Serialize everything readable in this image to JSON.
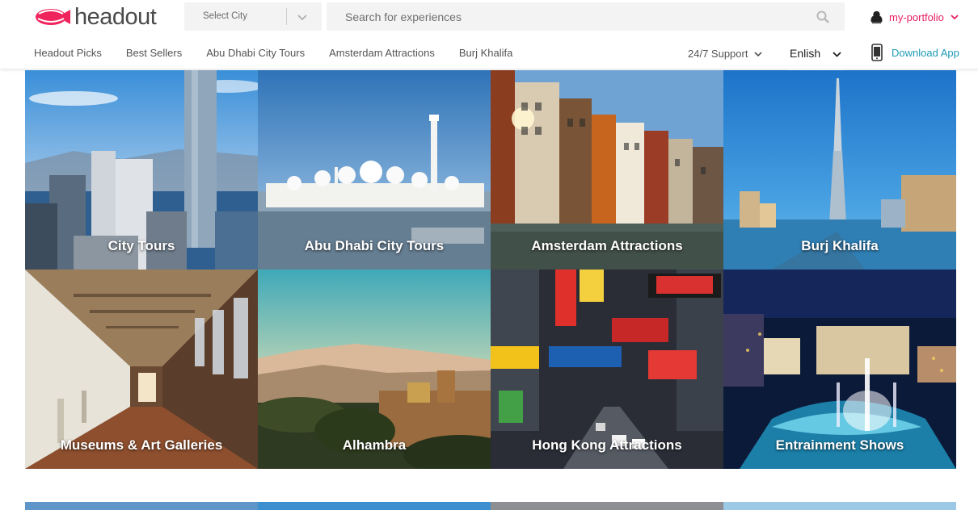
{
  "header": {
    "logo_text": "headout",
    "city_select": {
      "label": "Select City"
    },
    "search": {
      "placeholder": "Search for experiences"
    },
    "user": {
      "name": "my-portfolio"
    }
  },
  "nav": {
    "links": [
      "Headout Picks",
      "Best Sellers",
      "Abu Dhabi City Tours",
      "Amsterdam Attractions",
      "Burj Khalifa"
    ],
    "support": "24/7 Support",
    "language": "Enlish",
    "download": "Download App"
  },
  "colors": {
    "brand_pink": "#e91e63",
    "download_teal": "#1e9bb3"
  },
  "tiles": [
    {
      "title": "City Tours"
    },
    {
      "title": "Abu Dhabi City Tours"
    },
    {
      "title": "Amsterdam Attractions"
    },
    {
      "title": "Burj Khalifa"
    },
    {
      "title": "Museums & Art Galleries"
    },
    {
      "title": "Alhambra"
    },
    {
      "title": "Hong Kong Attractions"
    },
    {
      "title": "Entrainment Shows"
    }
  ]
}
